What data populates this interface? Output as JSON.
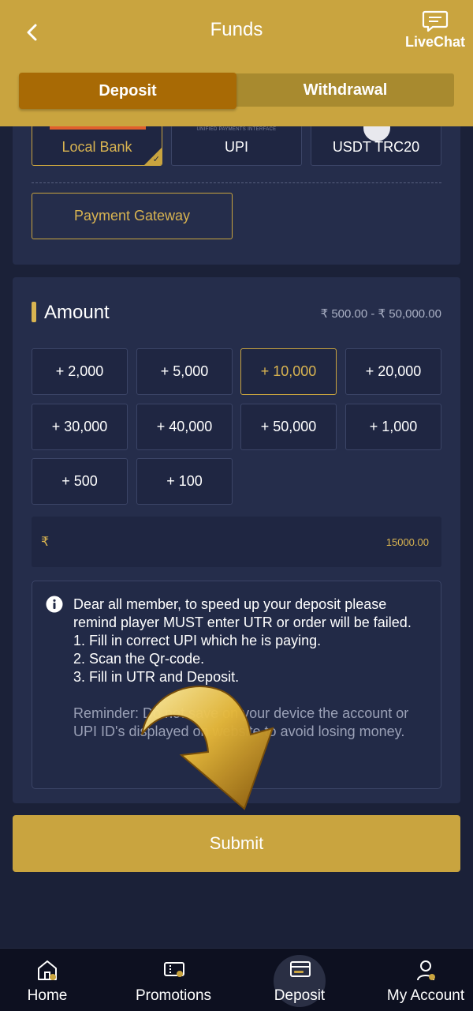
{
  "header": {
    "title": "Funds",
    "livechat_label": "LiveChat",
    "tabs": [
      {
        "label": "Deposit",
        "active": true
      },
      {
        "label": "Withdrawal",
        "active": false
      }
    ]
  },
  "payment_methods": {
    "items": [
      {
        "label": "Local Bank",
        "selected": true
      },
      {
        "label": "UPI",
        "sublabel": "UNIFIED PAYMENTS INTERFACE",
        "selected": false
      },
      {
        "label": "USDT TRC20",
        "selected": false
      }
    ],
    "gateway_label": "Payment Gateway"
  },
  "amount": {
    "title": "Amount",
    "range": "₹ 500.00 - ₹ 50,000.00",
    "chips": [
      "+ 2,000",
      "+ 5,000",
      "+ 10,000",
      "+ 20,000",
      "+ 30,000",
      "+ 40,000",
      "+ 50,000",
      "+ 1,000",
      "+ 500",
      "+ 100"
    ],
    "active_chip": "+ 10,000",
    "currency_symbol": "₹",
    "input_value": "15000.00"
  },
  "notice": {
    "lines": [
      "Dear all member, to speed up your deposit please remind player MUST enter UTR or order will be failed.",
      "1. Fill in correct UPI which he is paying.",
      "2. Scan the Qr-code.",
      "3. Fill in UTR and Deposit."
    ],
    "reminder": "Reminder: Do not save on your device the account or UPI ID's displayed on website to avoid losing money."
  },
  "submit_label": "Submit",
  "bottom_nav": [
    {
      "label": "Home",
      "icon": "home-icon"
    },
    {
      "label": "Promotions",
      "icon": "promotions-icon"
    },
    {
      "label": "Deposit",
      "icon": "deposit-icon",
      "active": true
    },
    {
      "label": "My Account",
      "icon": "account-icon"
    }
  ],
  "colors": {
    "accent": "#c9a43f",
    "background": "#1b2138",
    "card": "#252d4b",
    "active_tab": "#a86a05"
  }
}
